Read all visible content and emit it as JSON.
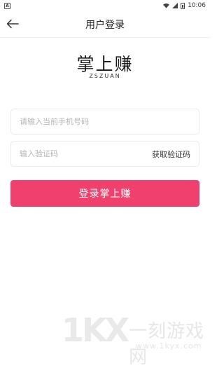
{
  "status_bar": {
    "notification_icon": "A",
    "time": "10:06"
  },
  "header": {
    "title": "用户登录",
    "back_icon": "arrow-left-icon"
  },
  "logo": {
    "title": "掌上赚",
    "subtitle": "ZSZUAN"
  },
  "form": {
    "phone_placeholder": "请输入当前手机号码",
    "phone_value": "",
    "code_placeholder": "输入验证码",
    "code_value": "",
    "get_code_label": "获取验证码",
    "login_label": "登录掌上赚"
  },
  "watermark": {
    "logo": "1KX",
    "name": "一刻游戏网",
    "url": "www.1kyx.com"
  },
  "colors": {
    "accent": "#f0416e",
    "border": "#ececec",
    "placeholder": "#b5b5b5"
  }
}
